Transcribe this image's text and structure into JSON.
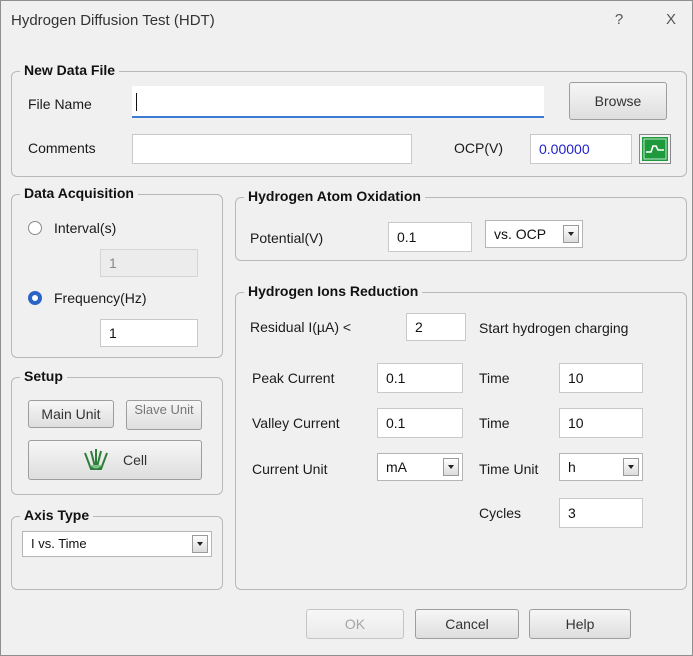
{
  "window": {
    "title": "Hydrogen Diffusion Test (HDT)",
    "help_glyph": "?",
    "close_glyph": "X"
  },
  "new_data_file": {
    "legend": "New Data File",
    "file_name_label": "File Name",
    "file_name_value": "",
    "browse_label": "Browse",
    "comments_label": "Comments",
    "comments_value": "",
    "ocp_label": "OCP(V)",
    "ocp_value": "0.00000"
  },
  "data_acquisition": {
    "legend": "Data Acquisition",
    "interval_label": "Interval(s)",
    "interval_value": "1",
    "frequency_label": "Frequency(Hz)",
    "frequency_value": "1",
    "selected": "frequency"
  },
  "setup": {
    "legend": "Setup",
    "main_unit_label": "Main Unit",
    "slave_unit_label": "Slave Unit",
    "cell_label": "Cell"
  },
  "axis_type": {
    "legend": "Axis Type",
    "selected": "I vs. Time"
  },
  "hydrogen_atom_oxidation": {
    "legend": "Hydrogen Atom Oxidation",
    "potential_label": "Potential(V)",
    "potential_value": "0.1",
    "reference_selected": "vs. OCP"
  },
  "hydrogen_ions_reduction": {
    "legend": "Hydrogen Ions Reduction",
    "residual_label": "Residual I(µA) <",
    "residual_value": "2",
    "start_charging_label": "Start hydrogen charging",
    "peak_current_label": "Peak Current",
    "peak_current_value": "0.1",
    "peak_time_label": "Time",
    "peak_time_value": "10",
    "valley_current_label": "Valley Current",
    "valley_current_value": "0.1",
    "valley_time_label": "Time",
    "valley_time_value": "10",
    "current_unit_label": "Current Unit",
    "current_unit_selected": "mA",
    "time_unit_label": "Time Unit",
    "time_unit_selected": "h",
    "cycles_label": "Cycles",
    "cycles_value": "3"
  },
  "footer": {
    "ok_label": "OK",
    "cancel_label": "Cancel",
    "help_label": "Help"
  },
  "colors": {
    "accent_blue": "#2b63c6",
    "ocp_text": "#2222cc",
    "ocp_button": "#1e9a3c"
  }
}
